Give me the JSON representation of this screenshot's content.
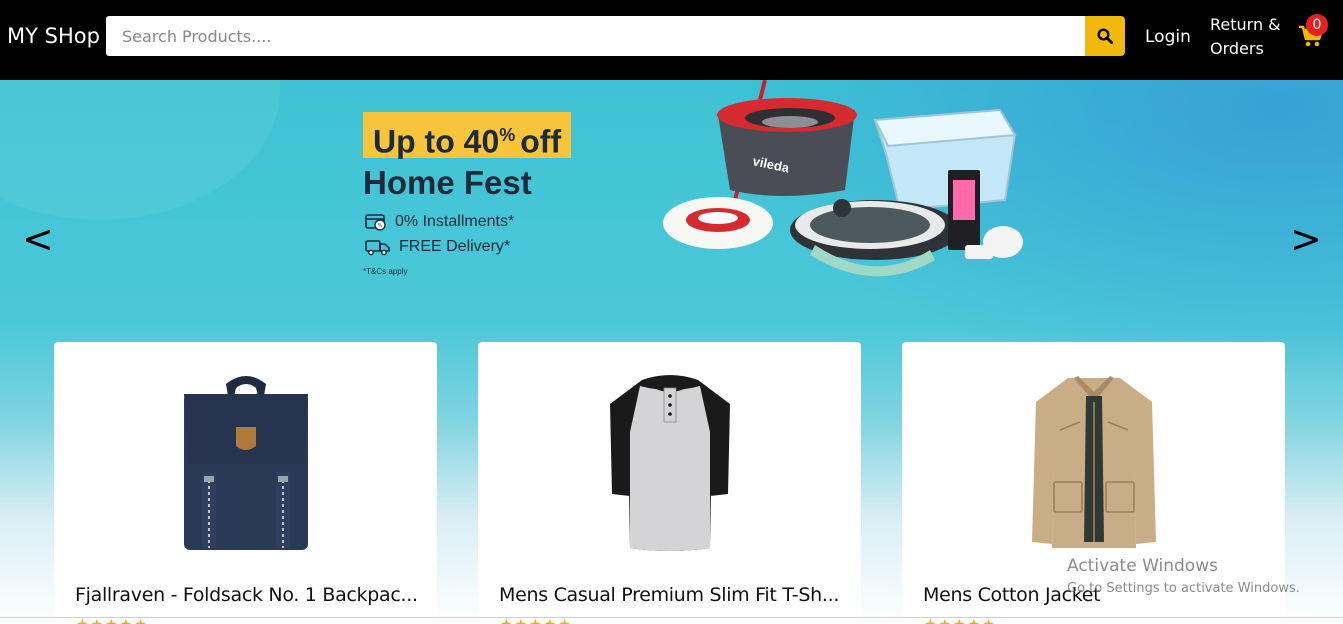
{
  "header": {
    "logo": "MY SHop",
    "search_placeholder": "Search Products....",
    "login": "Login",
    "returns": "Return & Orders",
    "cart_count": "0"
  },
  "banner": {
    "badge_text": "Up to 40",
    "badge_sup": "% ",
    "badge_suffix": "off",
    "title": "Home Fest",
    "line1": "0% Installments*",
    "line2": "FREE Delivery*",
    "terms": "*T&Cs apply",
    "logo_text": "vileda",
    "prev_arrow": "<",
    "next_arrow": ">"
  },
  "products": [
    {
      "title": "Fjallraven - Foldsack No. 1 Backpac...",
      "icon": "backpack-image"
    },
    {
      "title": "Mens Casual Premium Slim Fit T-Sh...",
      "icon": "tshirt-image"
    },
    {
      "title": "Mens Cotton Jacket",
      "icon": "jacket-image"
    }
  ],
  "stars": "★★★★★",
  "watermark": {
    "line1": "Activate Windows",
    "line2": "Go to Settings to activate Windows."
  },
  "colors": {
    "header_bg": "#000000",
    "accent": "#f0b90b",
    "badge": "#e52020",
    "hero": "#3ec3d4"
  }
}
